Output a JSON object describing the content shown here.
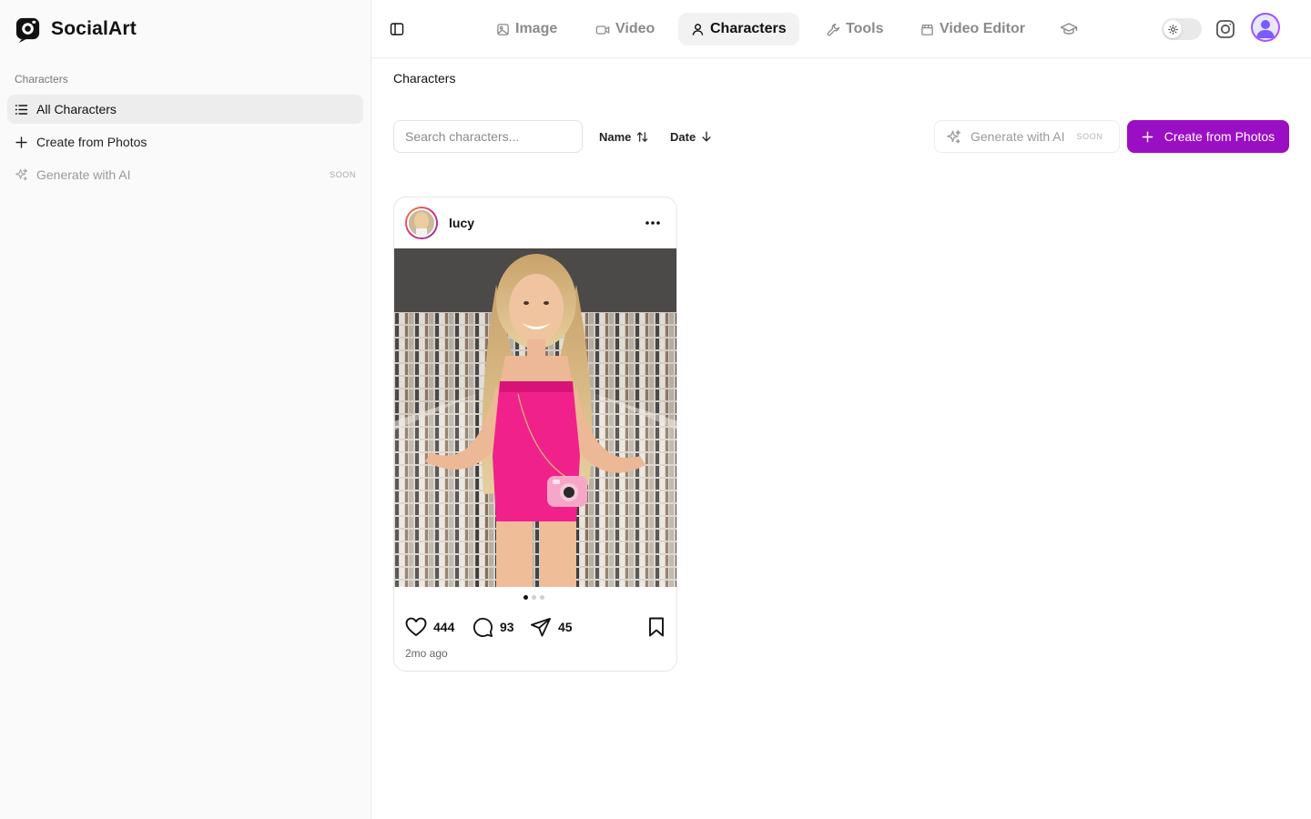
{
  "brand": {
    "name": "SocialArt"
  },
  "sidebar": {
    "section_label": "Characters",
    "items": [
      {
        "label": "All Characters",
        "icon": "list-icon",
        "active": true
      },
      {
        "label": "Create from Photos",
        "icon": "plus-icon"
      },
      {
        "label": "Generate with AI",
        "icon": "sparkles-icon",
        "badge": "SOON",
        "disabled": true
      }
    ]
  },
  "topnav": {
    "tabs": [
      {
        "label": "Image",
        "icon": "image-icon"
      },
      {
        "label": "Video",
        "icon": "video-icon"
      },
      {
        "label": "Characters",
        "icon": "user-icon",
        "active": true
      },
      {
        "label": "Tools",
        "icon": "wrench-icon"
      },
      {
        "label": "Video Editor",
        "icon": "clapperboard-icon"
      },
      {
        "label": "",
        "icon": "graduation-cap-icon"
      }
    ],
    "theme": "light"
  },
  "main": {
    "title": "Characters",
    "search": {
      "placeholder": "Search characters...",
      "value": ""
    },
    "sort": {
      "name_label": "Name",
      "date_label": "Date"
    },
    "generate_ai": {
      "label": "Generate with AI",
      "badge": "SOON"
    },
    "create_button": {
      "label": "Create from Photos"
    }
  },
  "characters": [
    {
      "name": "lucy",
      "likes": "444",
      "comments": "93",
      "shares": "45",
      "time_ago": "2mo ago",
      "image_count": 3,
      "current_image": 1
    }
  ],
  "colors": {
    "accent": "#9b0fc4",
    "sidebar_bg": "#fafafa",
    "active_item_bg": "#ededed"
  }
}
